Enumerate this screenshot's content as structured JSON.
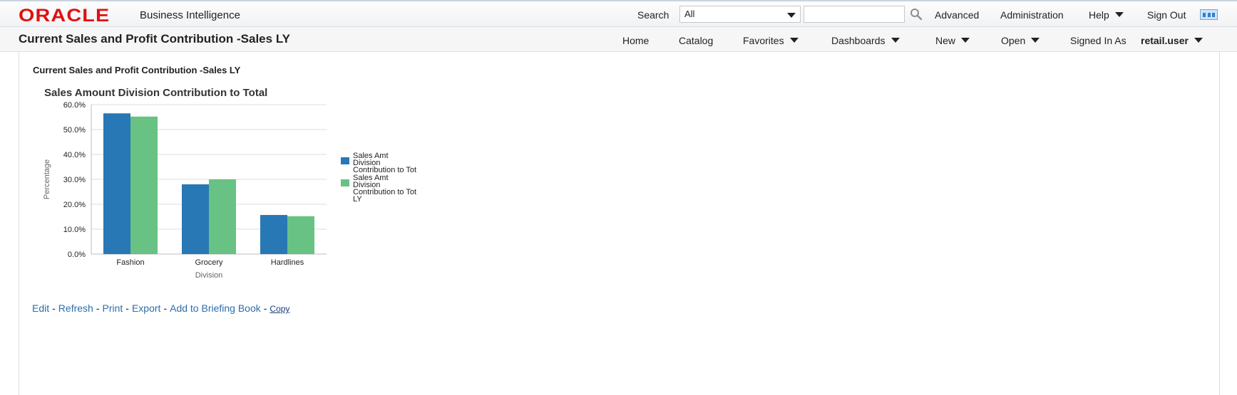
{
  "brand": {
    "logo": "ORACLE",
    "product": "Business Intelligence",
    "logo_color": "#e01010"
  },
  "topbar": {
    "search_label": "Search",
    "search_scope": "All",
    "search_placeholder": "",
    "advanced": "Advanced",
    "administration": "Administration",
    "help": "Help",
    "sign_out": "Sign Out"
  },
  "header": {
    "page_title": "Current Sales and Profit Contribution -Sales LY",
    "nav": {
      "home": "Home",
      "catalog": "Catalog",
      "favorites": "Favorites",
      "dashboards": "Dashboards",
      "new": "New",
      "open": "Open",
      "signed_in_label": "Signed In As",
      "user": "retail.user"
    }
  },
  "report": {
    "section_title": "Current Sales and Profit Contribution -Sales LY",
    "actions": {
      "edit": "Edit",
      "refresh": "Refresh",
      "print": "Print",
      "export": "Export",
      "briefing": "Add to Briefing Book",
      "copy": "Copy"
    }
  },
  "chart_data": {
    "type": "bar",
    "title": "Sales Amount Division Contribution to Total",
    "xlabel": "Division",
    "ylabel": "Percentage",
    "categories": [
      "Fashion",
      "Grocery",
      "Hardlines"
    ],
    "series": [
      {
        "name": "Sales Amt Division Contribution to Tot",
        "values": [
          56.5,
          28.0,
          15.7
        ],
        "color": "#2878b5"
      },
      {
        "name": "Sales Amt Division Contribution to Tot LY",
        "values": [
          55.2,
          30.0,
          15.2
        ],
        "color": "#67c283"
      }
    ],
    "ylim": [
      0,
      60
    ],
    "yticks": [
      "0.0%",
      "10.0%",
      "20.0%",
      "30.0%",
      "40.0%",
      "50.0%",
      "60.0%"
    ],
    "grid": true,
    "legend_position": "right",
    "link_color": "#2a6ead"
  }
}
